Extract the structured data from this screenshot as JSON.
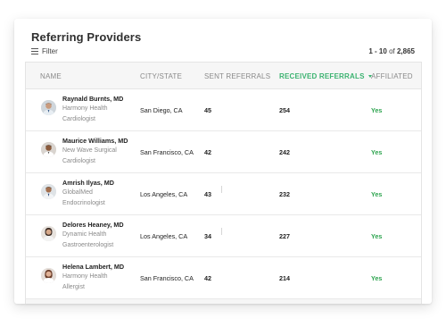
{
  "title": "Referring Providers",
  "filter_label": "Filter",
  "pagination": {
    "range": "1 - 10",
    "of": "of",
    "total": "2,865"
  },
  "columns": {
    "name": "Name",
    "city_state": "City/State",
    "sent": "Sent Referrals",
    "received": "Received Referrals",
    "affiliated": "Affiliated"
  },
  "sort": {
    "column": "received",
    "direction": "desc"
  },
  "colors": {
    "accent": "#3cb371",
    "affiliated_yes": "#2ea44f"
  },
  "rows": [
    {
      "name": "Raynald Burnts, MD",
      "org": "Harmony Health",
      "specialty": "Cardiologist",
      "city": "San Diego, CA",
      "sent": "45",
      "received": "254",
      "affiliated": "Yes"
    },
    {
      "name": "Maurice Williams, MD",
      "org": "New Wave Surgical",
      "specialty": "Cardiologist",
      "city": "San Francisco, CA",
      "sent": "42",
      "received": "242",
      "affiliated": "Yes"
    },
    {
      "name": "Amrish Ilyas, MD",
      "org": "GlobalMed",
      "specialty": "Endocrinologist",
      "city": "Los Angeles, CA",
      "sent": "43",
      "received": "232",
      "affiliated": "Yes"
    },
    {
      "name": "Delores Heaney, MD",
      "org": "Dynamic Health",
      "specialty": "Gastroenterologist",
      "city": "Los Angeles, CA",
      "sent": "34",
      "received": "227",
      "affiliated": "Yes"
    },
    {
      "name": "Helena Lambert, MD",
      "org": "Harmony Health",
      "specialty": "Allergist",
      "city": "San Francisco, CA",
      "sent": "42",
      "received": "214",
      "affiliated": "Yes"
    }
  ]
}
